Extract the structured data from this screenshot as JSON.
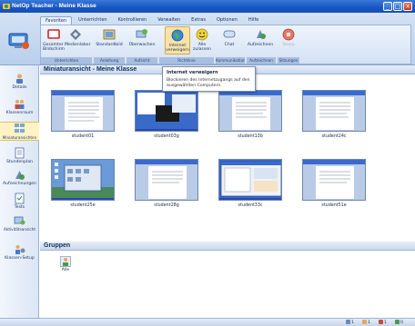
{
  "window": {
    "title": "NetOp Teacher - Meine Klasse",
    "controls": {
      "minimize": "_",
      "maximize": "□",
      "close": "×"
    }
  },
  "ribbon": {
    "tabs": [
      {
        "label": "Favoriten",
        "active": true
      },
      {
        "label": "Unterrichten"
      },
      {
        "label": "Kontrollieren"
      },
      {
        "label": "Verwalten"
      },
      {
        "label": "Extras"
      },
      {
        "label": "Optionen"
      },
      {
        "label": "Hilfe"
      }
    ],
    "tools": [
      {
        "label": "Gesamter Medienlabor",
        "sub": "Bildschirm"
      },
      {
        "label": "Standardbild"
      },
      {
        "label": "Überwachen"
      },
      {
        "label": "Internet",
        "sub": "verweigern"
      },
      {
        "label": "Alle",
        "sub": "zulassen"
      },
      {
        "label": "Chat"
      },
      {
        "label": "Aufzeichnen"
      },
      {
        "label": "Stopp"
      }
    ],
    "groups": [
      "Unterrichten",
      "Anleitung",
      "Aufsicht",
      "Richtlinie",
      "Kommunikation",
      "Aufzeichnen",
      "Sitzungen"
    ]
  },
  "tooltip": {
    "title": "Internet verweigern",
    "body": "Blockieren des Internetzugangs auf den ausgewählten Computern."
  },
  "sidebar": {
    "items": [
      "Details",
      "Klassenraum",
      "Miniaturansichten",
      "Stundenplan",
      "Aufzeichnungen",
      "Tests",
      "Aktivitätsansicht",
      "Klassen-Setup"
    ]
  },
  "main": {
    "thumbnails_title": "Miniaturansicht - Meine Klasse",
    "students": [
      "student01",
      "student03g",
      "student13b",
      "student24c",
      "student25e",
      "student28g",
      "student33c",
      "student51e"
    ],
    "groups_title": "Gruppen",
    "group_items": [
      "Alle"
    ]
  },
  "status": {
    "items": [
      "1",
      "1",
      "1",
      "0"
    ]
  },
  "colors": {
    "accent": "#1656c4",
    "ribbon": "#c9d8ee"
  }
}
